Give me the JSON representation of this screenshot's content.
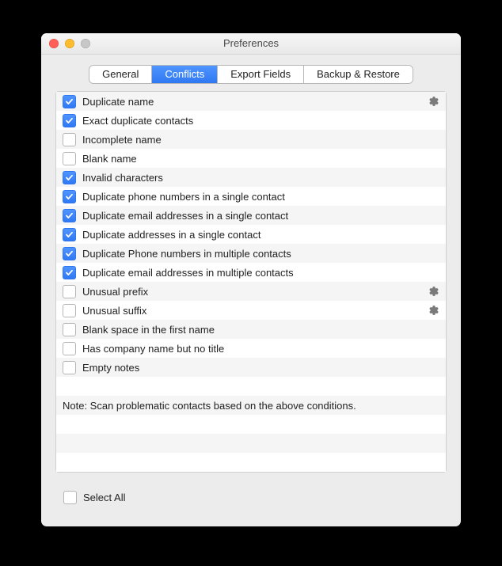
{
  "window": {
    "title": "Preferences"
  },
  "tabs": [
    {
      "label": "General",
      "active": false
    },
    {
      "label": "Conflicts",
      "active": true
    },
    {
      "label": "Export Fields",
      "active": false
    },
    {
      "label": "Backup & Restore",
      "active": false
    }
  ],
  "conflicts": {
    "items": [
      {
        "label": "Duplicate name",
        "checked": true,
        "gear": true
      },
      {
        "label": "Exact duplicate contacts",
        "checked": true,
        "gear": false
      },
      {
        "label": "Incomplete name",
        "checked": false,
        "gear": false
      },
      {
        "label": "Blank name",
        "checked": false,
        "gear": false
      },
      {
        "label": "Invalid characters",
        "checked": true,
        "gear": false
      },
      {
        "label": "Duplicate phone numbers in a single contact",
        "checked": true,
        "gear": false
      },
      {
        "label": "Duplicate email addresses in a single contact",
        "checked": true,
        "gear": false
      },
      {
        "label": "Duplicate addresses in a single contact",
        "checked": true,
        "gear": false
      },
      {
        "label": "Duplicate Phone numbers in multiple contacts",
        "checked": true,
        "gear": false
      },
      {
        "label": "Duplicate email addresses in multiple contacts",
        "checked": true,
        "gear": false
      },
      {
        "label": "Unusual prefix",
        "checked": false,
        "gear": true
      },
      {
        "label": "Unusual suffix",
        "checked": false,
        "gear": true
      },
      {
        "label": "Blank space in the first name",
        "checked": false,
        "gear": false
      },
      {
        "label": "Has company name but no title",
        "checked": false,
        "gear": false
      },
      {
        "label": "Empty notes",
        "checked": false,
        "gear": false
      }
    ],
    "note": "Note: Scan problematic contacts based on the above conditions.",
    "trailing_blank_rows": 3
  },
  "footer": {
    "select_all": "Select All",
    "select_all_checked": false
  }
}
